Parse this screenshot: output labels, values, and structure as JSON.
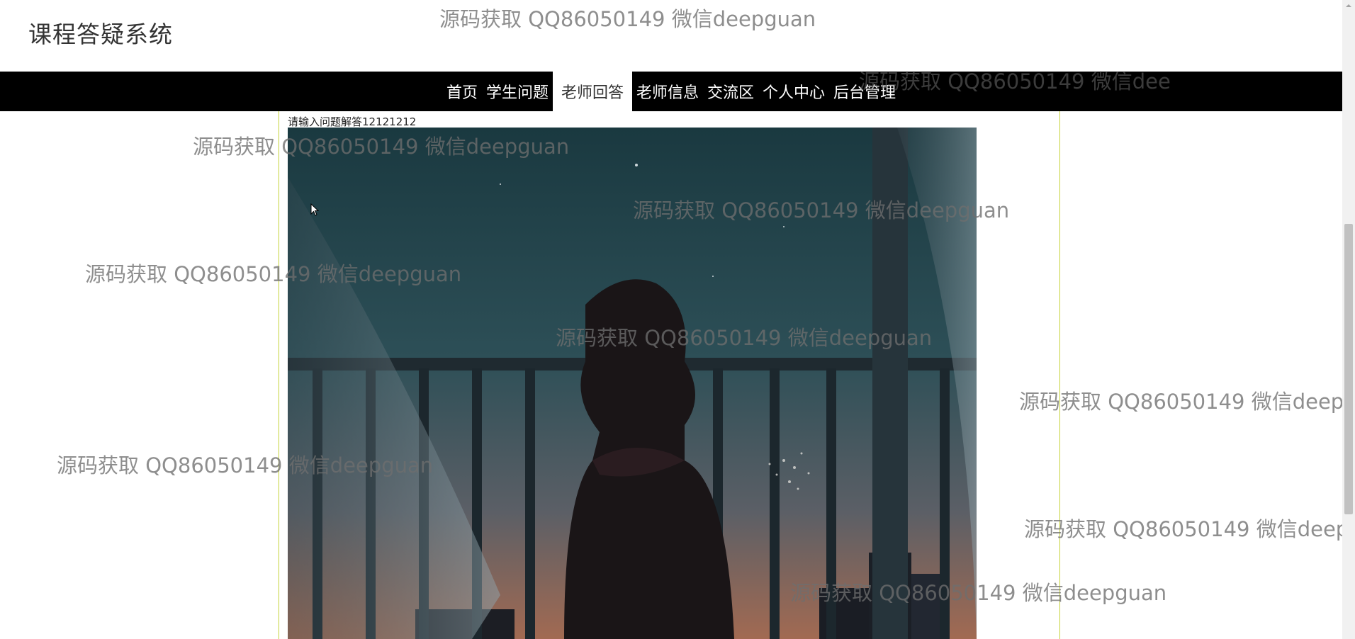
{
  "app": {
    "title": "课程答疑系统"
  },
  "nav": {
    "items": [
      {
        "label": "首页"
      },
      {
        "label": "学生问题"
      },
      {
        "label": "老师回答",
        "active": true
      },
      {
        "label": "老师信息"
      },
      {
        "label": "交流区"
      },
      {
        "label": "个人中心"
      },
      {
        "label": "后台管理"
      }
    ]
  },
  "answer": {
    "title": "请输入问题解答12121212",
    "image_icon": "answer-photo-anime-girl-balcony-night"
  },
  "watermark": {
    "text": "源码获取 QQ86050149 微信deepguan",
    "partial_1": "源码获取 QQ86050149 微信deepg",
    "partial_2": "源码获取 QQ86050149 微信deep",
    "partial_3": "源码获取 QQ86050149 微信dee"
  },
  "colors": {
    "nav_bg": "#000000",
    "nav_text": "#ffffff",
    "frame_border": "#c6d43a",
    "watermark": "#6e6e6e"
  }
}
